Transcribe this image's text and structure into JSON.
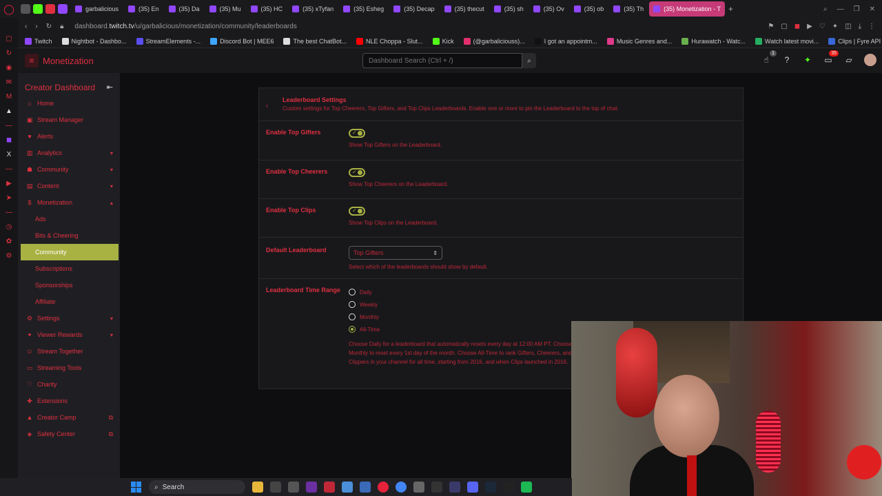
{
  "browser": {
    "pinned_tabs": [
      {
        "name": "apple",
        "color": "#555"
      },
      {
        "name": "kick",
        "color": "#53fc18"
      },
      {
        "name": "pin3",
        "color": "#e03040"
      },
      {
        "name": "pin4",
        "color": "#9147ff"
      }
    ],
    "tabs": [
      {
        "label": "garbalicious",
        "active": false
      },
      {
        "label": "(35) En",
        "active": false
      },
      {
        "label": "(35) Da",
        "active": false
      },
      {
        "label": "(35) Mu",
        "active": false
      },
      {
        "label": "(35) HC",
        "active": false
      },
      {
        "label": "(35) xTyfan",
        "active": false
      },
      {
        "label": "(35) Esheg",
        "active": false
      },
      {
        "label": "(35) Decap",
        "active": false
      },
      {
        "label": "(35) thecut",
        "active": false
      },
      {
        "label": "(35) sh",
        "active": false
      },
      {
        "label": "(35) Ov",
        "active": false
      },
      {
        "label": "(35) ob",
        "active": false
      },
      {
        "label": "(35) Th",
        "active": false
      },
      {
        "label": "(35) Monetization - T",
        "active": true
      }
    ],
    "url_prefix": "dashboard.",
    "url_host": "twitch.tv",
    "url_path": "/u/garbalicious/monetization/community/leaderboards",
    "bookmarks": [
      {
        "label": "Twitch",
        "color": "#9147ff"
      },
      {
        "label": "Nightbot - Dashbo...",
        "color": "#ddd"
      },
      {
        "label": "StreamElements -...",
        "color": "#5b4ef3"
      },
      {
        "label": "Discord Bot | MEE6",
        "color": "#3ea6ff"
      },
      {
        "label": "The best ChatBot...",
        "color": "#ddd"
      },
      {
        "label": "NLE Choppa - Slut...",
        "color": "#ff0000"
      },
      {
        "label": "Kick",
        "color": "#53fc18"
      },
      {
        "label": "(@garbaliciouss)...",
        "color": "#e1306c"
      },
      {
        "label": "I got an appointm...",
        "color": "#111"
      },
      {
        "label": "Music Genres and...",
        "color": "#e03a8a"
      },
      {
        "label": "Hurawatch - Watc...",
        "color": "#6ab04c"
      },
      {
        "label": "Watch latest movi...",
        "color": "#27ae60"
      },
      {
        "label": "Clips | Fyre API",
        "color": "#3867d6"
      }
    ]
  },
  "topnav": {
    "title": "Monetization",
    "search_placeholder": "Dashboard Search (Ctrl + /)",
    "notif_badge": "1",
    "inbox_badge": "35"
  },
  "sidebar": {
    "title": "Creator Dashboard",
    "items": [
      {
        "label": "Home",
        "icon": "home-icon",
        "glyph": "⌂",
        "chev": ""
      },
      {
        "label": "Stream Manager",
        "icon": "stream-manager-icon",
        "glyph": "▣",
        "chev": ""
      },
      {
        "label": "Alerts",
        "icon": "alerts-icon",
        "glyph": "♥",
        "chev": ""
      },
      {
        "label": "Analytics",
        "icon": "analytics-icon",
        "glyph": "▥",
        "chev": "▾"
      },
      {
        "label": "Community",
        "icon": "community-icon",
        "glyph": "☗",
        "chev": "▾"
      },
      {
        "label": "Content",
        "icon": "content-icon",
        "glyph": "▤",
        "chev": "▾"
      },
      {
        "label": "Monetization",
        "icon": "monetization-icon",
        "glyph": "$",
        "chev": "▴"
      }
    ],
    "sub_items": [
      {
        "label": "Ads",
        "active": false
      },
      {
        "label": "Bits & Cheering",
        "active": false
      },
      {
        "label": "Community",
        "active": true
      },
      {
        "label": "Subscriptions",
        "active": false
      },
      {
        "label": "Sponsorships",
        "active": false
      },
      {
        "label": "Affiliate",
        "active": false
      }
    ],
    "items_after": [
      {
        "label": "Settings",
        "icon": "settings-icon",
        "glyph": "⚙",
        "chev": "▾",
        "ext": ""
      },
      {
        "label": "Viewer Rewards",
        "icon": "viewer-rewards-icon",
        "glyph": "✦",
        "chev": "▾",
        "ext": ""
      },
      {
        "label": "Stream Together",
        "icon": "stream-together-icon",
        "glyph": "☺",
        "chev": "",
        "ext": ""
      },
      {
        "label": "Streaming Tools",
        "icon": "streaming-tools-icon",
        "glyph": "▭",
        "chev": "",
        "ext": ""
      },
      {
        "label": "Charity",
        "icon": "charity-icon",
        "glyph": "♡",
        "chev": "",
        "ext": ""
      },
      {
        "label": "Extensions",
        "icon": "extensions-icon",
        "glyph": "✚",
        "chev": "",
        "ext": ""
      },
      {
        "label": "Creator Camp",
        "icon": "creator-camp-icon",
        "glyph": "▲",
        "chev": "",
        "ext": "⧉"
      },
      {
        "label": "Safety Center",
        "icon": "safety-center-icon",
        "glyph": "◈",
        "chev": "",
        "ext": "⧉"
      }
    ]
  },
  "card": {
    "title": "Leaderboard Settings",
    "description": "Custom settings for Top Cheerers, Top Gifters, and Top Clips Leaderboards. Enable one or more to pin the Leaderboard to the top of chat.",
    "toggles": [
      {
        "label": "Enable Top Gifters",
        "desc": "Show Top Gifters on the Leaderboard.",
        "on": true
      },
      {
        "label": "Enable Top Cheerers",
        "desc": "Show Top Cheerers on the Leaderboard.",
        "on": true
      },
      {
        "label": "Enable Top Clips",
        "desc": "Show Top Clips on the Leaderboard.",
        "on": true
      }
    ],
    "default_label": "Default Leaderboard",
    "default_value": "Top Gifters",
    "default_desc": "Select which of the leaderboards should show by default.",
    "time_label": "Leaderboard Time Range",
    "time_options": [
      {
        "label": "Daily",
        "selected": false
      },
      {
        "label": "Weekly",
        "selected": false
      },
      {
        "label": "Monthly",
        "selected": false
      },
      {
        "label": "All-Time",
        "selected": true
      }
    ],
    "time_desc": "Choose Daily for a leaderboard that automatically resets every day at 12:00 AM PT. Choose Monthly to reset every 1st day of the month. Choose All-Time to rank Gifters, Cheerers, and Clippers in your channel for all time, starting from 2016, and when Clips launched in 2016."
  },
  "taskbar": {
    "search_label": "Search"
  },
  "colors": {
    "accent_red": "#e03040",
    "active_highlight": "#a8b243",
    "active_tab": "#c53a77"
  }
}
